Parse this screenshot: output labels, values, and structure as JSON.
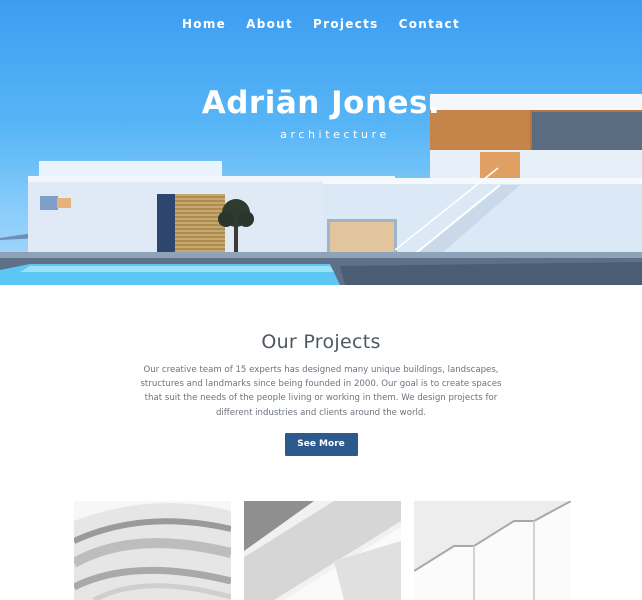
{
  "nav": {
    "items": [
      {
        "label": "Home"
      },
      {
        "label": "About"
      },
      {
        "label": "Projects"
      },
      {
        "label": "Contact"
      }
    ]
  },
  "brand": {
    "name": "Adriān Jones.",
    "tagline": "architecture"
  },
  "projects": {
    "title": "Our Projects",
    "description": "Our creative team of 15 experts has designed many unique buildings, landscapes, structures and landmarks since being founded in 2000. Our goal is to create spaces that suit the needs of the people living or working in them. We design projects for different industries and clients around the world.",
    "button_label": "See More",
    "button_color": "#2d5a8c"
  },
  "colors": {
    "sky": "#4aa8f2",
    "text": "#5a6470"
  }
}
